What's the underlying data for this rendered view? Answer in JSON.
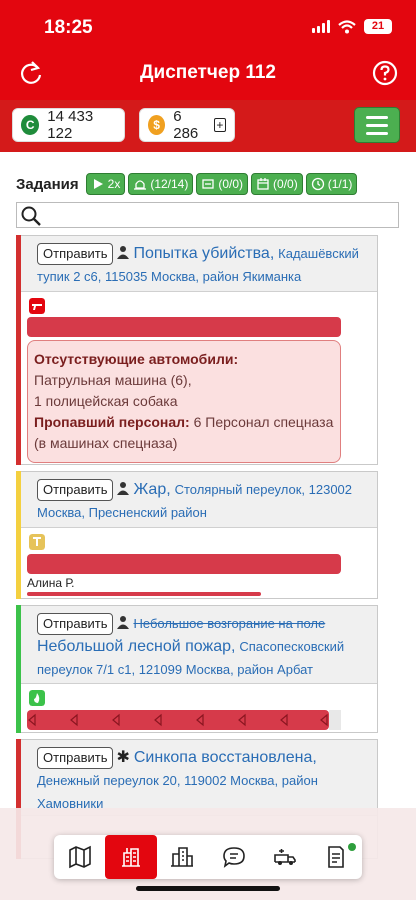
{
  "status_bar": {
    "time": "18:25",
    "battery": "21"
  },
  "header": {
    "title": "Диспетчер 112"
  },
  "balance": {
    "credits": "14 433 122",
    "coins": "6 286",
    "credit_symbol": "C",
    "coin_symbol": "$",
    "plus": "+"
  },
  "tasks": {
    "title": "Задания",
    "speed": "2x",
    "counters": [
      "(12/14)",
      "(0/0)",
      "(0/0)",
      "(1/1)"
    ]
  },
  "search": {
    "placeholder": ""
  },
  "missions": [
    {
      "send_label": "Отправить",
      "name": "Попытка убийства,",
      "address": "Кадашёвский тупик 2 с6, 115035 Москва, район Якиманка",
      "status_color": "#d32f2f",
      "missing_vehicles_label": "Отсутствующие автомобили:",
      "missing_vehicles": [
        "Патрульная машина (6),",
        "1 полицейская собака"
      ],
      "missing_personnel_label": "Пропавший персонал:",
      "missing_personnel": "6 Персонал спецназа (в машинах спецназа)"
    },
    {
      "send_label": "Отправить",
      "name": "Жар,",
      "address": "Столярный переулок, 123002 Москва, Пресненский район",
      "status_color": "#f4d03f",
      "responder": "Алина Р."
    },
    {
      "send_label": "Отправить",
      "old_name": "Небольшое возгорание на поле",
      "name": "Небольшой лесной пожар,",
      "address": "Спасопесковский переулок 7/1 с1, 121099 Москва, район Арбат",
      "status_color": "#3cc24a"
    },
    {
      "send_label": "Отправить",
      "name": "Синкопа восстановлена,",
      "address": "Денежный переулок 20, 119002 Москва, район Хамовники",
      "status_color": "#d32f2f"
    }
  ],
  "tabbar": {
    "items": [
      {
        "icon": "map-icon",
        "active": false
      },
      {
        "icon": "dispatch-icon",
        "active": true
      },
      {
        "icon": "buildings-icon",
        "active": false
      },
      {
        "icon": "chat-icon",
        "active": false
      },
      {
        "icon": "vehicles-icon",
        "active": false
      },
      {
        "icon": "reports-icon",
        "active": false
      }
    ]
  },
  "colors": {
    "primary_red": "#e3060f",
    "green": "#4caf50",
    "link_blue": "#2a6db5"
  }
}
